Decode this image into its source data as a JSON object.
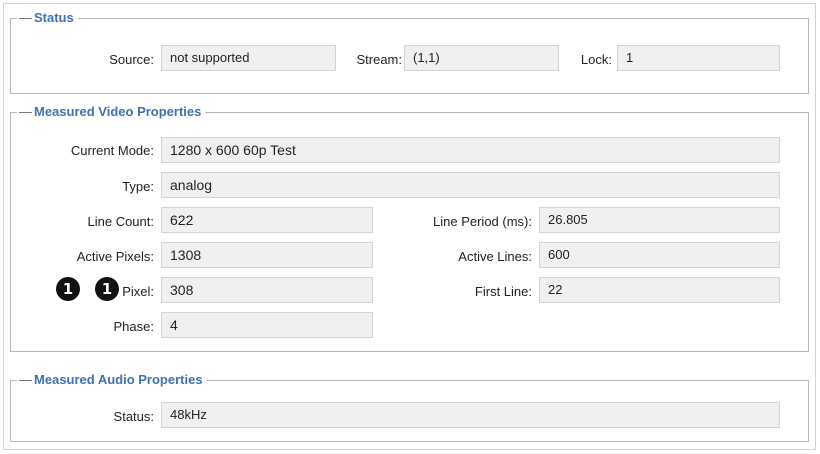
{
  "status": {
    "title": "Status",
    "source": {
      "label": "Source:",
      "value": "not supported"
    },
    "stream": {
      "label": "Stream:",
      "value": "(1,1)"
    },
    "lock": {
      "label": "Lock:",
      "value": "1"
    }
  },
  "video": {
    "title": "Measured Video Properties",
    "current_mode": {
      "label": "Current Mode:",
      "value": "1280 x 600 60p Test"
    },
    "type": {
      "label": "Type:",
      "value": "analog"
    },
    "line_count": {
      "label": "Line Count:",
      "value": "622"
    },
    "line_period": {
      "label": "Line Period (ms):",
      "value": "26.805"
    },
    "active_pixels": {
      "label": "Active Pixels:",
      "value": "1308"
    },
    "active_lines": {
      "label": "Active Lines:",
      "value": "600"
    },
    "first_pixel": {
      "label": "Pixel:",
      "value": "308"
    },
    "first_line": {
      "label": "First Line:",
      "value": "22"
    },
    "phase": {
      "label": "Phase:",
      "value": "4"
    }
  },
  "audio": {
    "title": "Measured Audio Properties",
    "status": {
      "label": "Status:",
      "value": "48kHz"
    }
  },
  "callouts": [
    "1",
    "1"
  ]
}
